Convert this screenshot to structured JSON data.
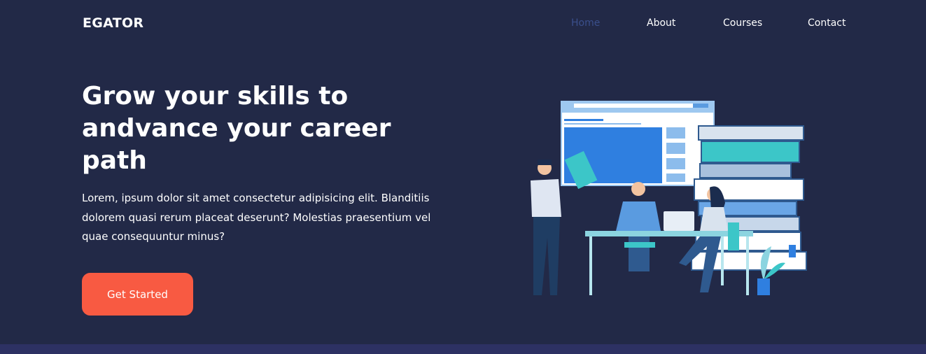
{
  "nav": {
    "logo": "EGATOR",
    "links": [
      "Home",
      "About",
      "Courses",
      "Contact"
    ],
    "active": "Home"
  },
  "hero": {
    "title": "Grow your skills to andvance your career path",
    "description": "Lorem, ipsum dolor sit amet consectetur adipisicing elit. Blanditiis dolorem quasi rerum placeat deserunt? Molestias praesentium vel quae consequuntur minus?",
    "cta_label": "Get Started"
  },
  "colors": {
    "background": "#222947",
    "accent": "#f85a42",
    "nav_active": "#3a4f8c",
    "footer_strip": "#2d3163"
  },
  "icons": {
    "illustration": "online-learning-team-illustration"
  }
}
